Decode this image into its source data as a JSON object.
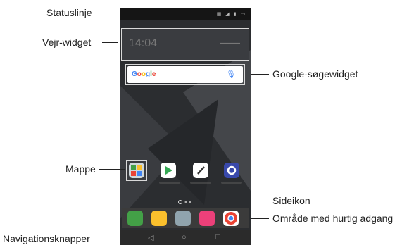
{
  "callouts": {
    "status_bar": "Statuslinje",
    "weather_widget": "Vejr-widget",
    "google_search_widget": "Google-søgewidget",
    "folder": "Mappe",
    "page_icon": "Sideikon",
    "quick_access": "Område med hurtig adgang",
    "nav_buttons": "Navigationsknapper"
  },
  "phone": {
    "weather_time": "14:04",
    "search_logo": "Google",
    "nav": {
      "back": "◁",
      "home": "○",
      "recents": "□"
    }
  },
  "colors": {
    "phone_icon": "#43a047",
    "messages_icon": "#fbc02d",
    "camera_icon": "#90a4ae",
    "gallery_icon": "#ec407a",
    "chrome_icon": "#ffffff",
    "settings_icon": "#3949ab"
  }
}
